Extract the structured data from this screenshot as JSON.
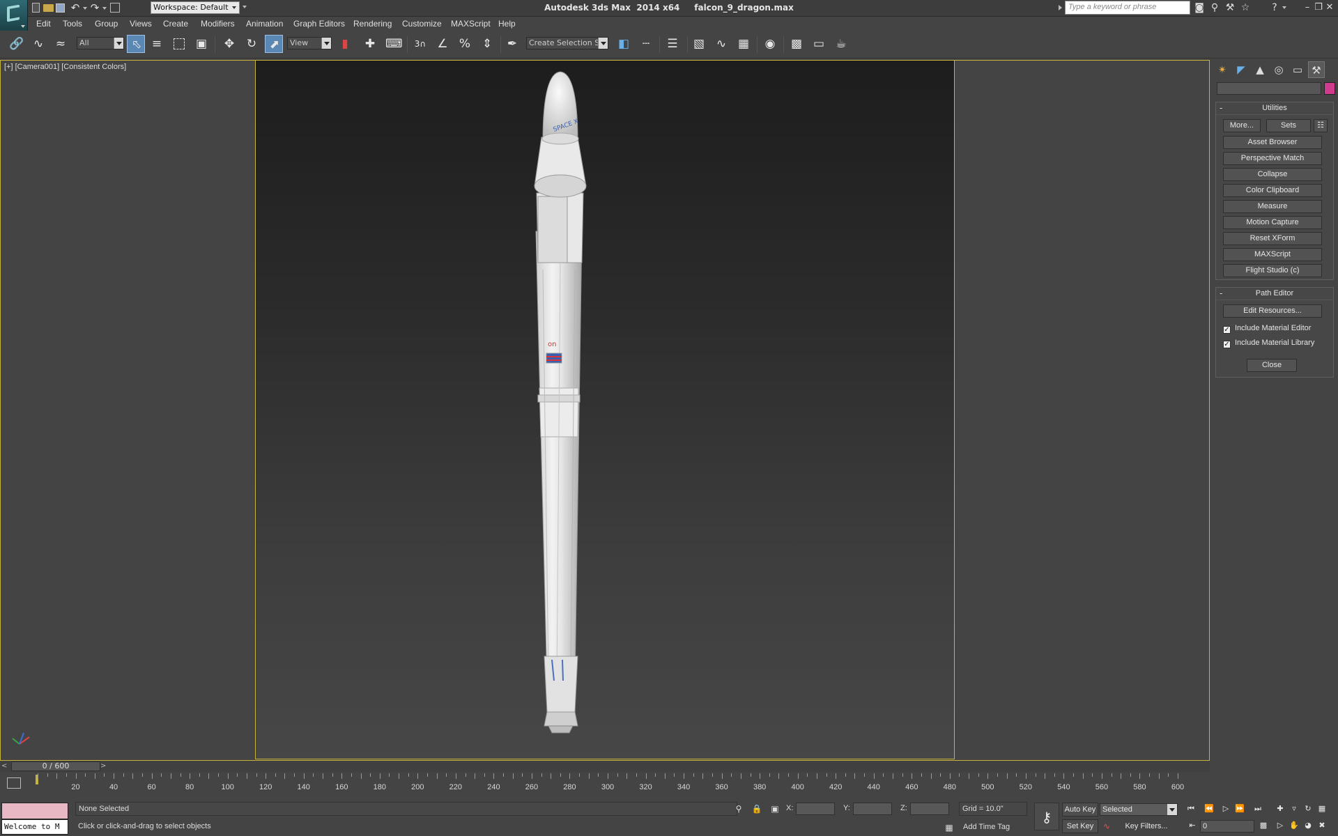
{
  "titlebar": {
    "workspace": "Workspace: Default",
    "app_title": "Autodesk 3ds Max  2014 x64     falcon_9_dragon.max",
    "search_placeholder": "Type a keyword or phrase"
  },
  "menu": [
    "Edit",
    "Tools",
    "Group",
    "Views",
    "Create",
    "Modifiers",
    "Animation",
    "Graph Editors",
    "Rendering",
    "Customize",
    "MAXScript",
    "Help"
  ],
  "toolbar": {
    "selection_filter": "All",
    "reference_coord": "View",
    "named_selection": "Create Selection Se",
    "snap_label": "3"
  },
  "viewport": {
    "label": "[+] [Camera001] [Consistent Colors]",
    "scene_text": "SPACE X",
    "falcon_text": "on"
  },
  "command_panel": {
    "utilities_title": "Utilities",
    "more_label": "More...",
    "sets_label": "Sets",
    "utility_buttons": [
      "Asset Browser",
      "Perspective Match",
      "Collapse",
      "Color Clipboard",
      "Measure",
      "Motion Capture",
      "Reset XForm",
      "MAXScript",
      "Flight Studio (c)"
    ],
    "path_editor_title": "Path Editor",
    "edit_resources_label": "Edit Resources...",
    "include_material_editor": "Include Material Editor",
    "include_material_library": "Include Material Library",
    "close_label": "Close"
  },
  "timeline": {
    "frame_display": "0 / 600",
    "prev": "<",
    "next": ">",
    "ticks": [
      "20",
      "40",
      "60",
      "80",
      "100",
      "120",
      "140",
      "160",
      "180",
      "200",
      "220",
      "240",
      "260",
      "280",
      "300",
      "320",
      "340",
      "360",
      "380",
      "400",
      "420",
      "440",
      "460",
      "480",
      "500",
      "520",
      "540",
      "560",
      "580",
      "600"
    ]
  },
  "status": {
    "maxscript_text": "Welcome to M",
    "selection": "None Selected",
    "prompt": "Click or click-and-drag to select objects",
    "x_label": "X:",
    "y_label": "Y:",
    "z_label": "Z:",
    "grid": "Grid = 10.0\"",
    "add_time_tag": "Add Time Tag",
    "auto_key": "Auto Key",
    "set_key": "Set Key",
    "key_mode": "Selected",
    "key_filters": "Key Filters...",
    "current_frame": "0"
  },
  "colors": {
    "accent_blue": "#5b87b5",
    "viewport_border": "#c8b43c",
    "object_color": "#d13b8d"
  }
}
